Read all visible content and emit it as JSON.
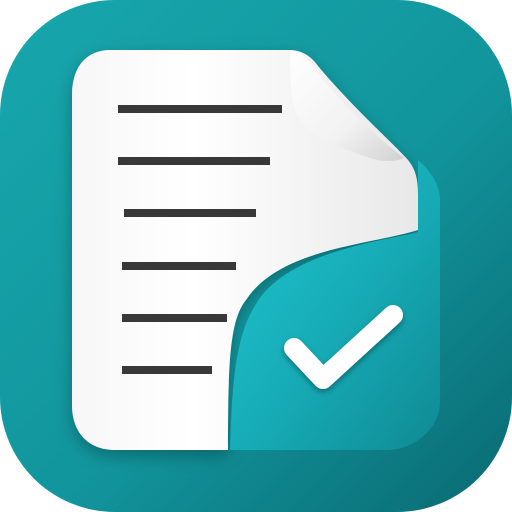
{
  "icon": {
    "name": "document-approved-app-icon",
    "symbol": "check-icon",
    "colors": {
      "tile_light": "#169fa6",
      "tile_dark": "#0b6d75",
      "inner_light": "#1cc2cf",
      "inner_dark": "#0f8f98",
      "paper": "#ffffff",
      "paper_shade": "#dcdcdc",
      "line": "#3a3a3a",
      "check": "#ffffff"
    },
    "text_lines": 6
  }
}
